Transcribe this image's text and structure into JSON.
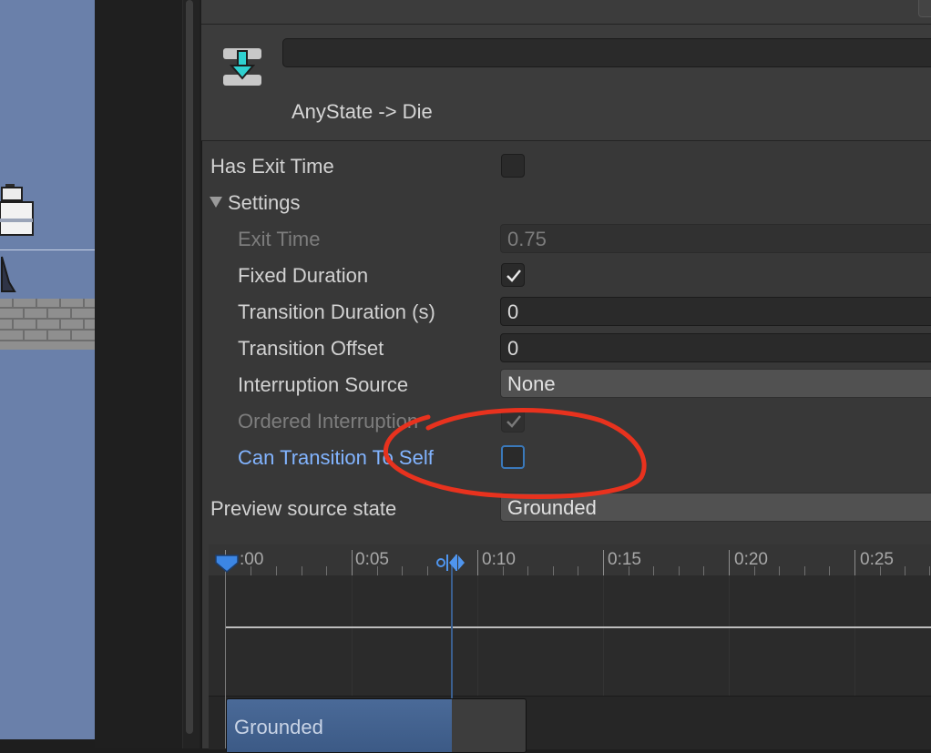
{
  "inspector": {
    "title": "AnyState -> Die",
    "name_field_value": "",
    "header_icon": "transition-icon"
  },
  "settings": {
    "has_exit_time_label": "Has Exit Time",
    "has_exit_time_checked": false,
    "section_label": "Settings",
    "exit_time_label": "Exit Time",
    "exit_time_value": "0.75",
    "fixed_duration_label": "Fixed Duration",
    "fixed_duration_checked": true,
    "transition_duration_label": "Transition Duration (s)",
    "transition_duration_value": "0",
    "transition_offset_label": "Transition Offset",
    "transition_offset_value": "0",
    "interruption_source_label": "Interruption Source",
    "interruption_source_value": "None",
    "ordered_interruption_label": "Ordered Interruption",
    "ordered_interruption_checked": true,
    "can_transition_to_self_label": "Can Transition To Self",
    "can_transition_to_self_checked": false,
    "preview_source_state_label": "Preview source state",
    "preview_source_state_value": "Grounded"
  },
  "timeline": {
    "ticks": [
      ":00",
      "0:05",
      "0:10",
      "0:15",
      "0:20",
      "0:25"
    ],
    "clip_label": "Grounded"
  },
  "colors": {
    "annotation_circle": "#e8321e",
    "highlight_label": "#82b4ff",
    "scene_background": "#6a80aa",
    "timeline_marker": "#3c86e4"
  }
}
